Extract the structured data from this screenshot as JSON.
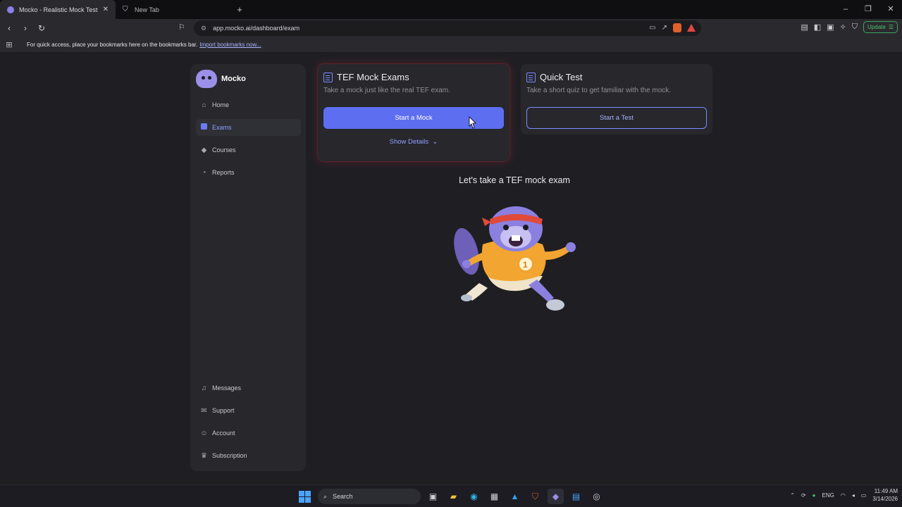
{
  "browser": {
    "tabs": [
      {
        "title": "Mocko - Realistic Mock Tests wi",
        "active": true
      },
      {
        "title": "New Tab",
        "active": false
      }
    ],
    "url": "app.mocko.ai/dashboard/exam",
    "update_label": "Update",
    "bookmarks_message": "For quick access, place your bookmarks here on the bookmarks bar.",
    "bookmarks_link": "Import bookmarks now..."
  },
  "sidebar": {
    "brand": "Mocko",
    "top_items": [
      {
        "label": "Home",
        "icon": "home-icon"
      },
      {
        "label": "Exams",
        "icon": "exams-icon",
        "active": true
      },
      {
        "label": "Courses",
        "icon": "graduation-cap-icon"
      },
      {
        "label": "Reports",
        "icon": "chart-pie-icon"
      }
    ],
    "bottom_items": [
      {
        "label": "Messages",
        "icon": "bell-icon"
      },
      {
        "label": "Support",
        "icon": "mail-icon"
      },
      {
        "label": "Account",
        "icon": "user-icon"
      },
      {
        "label": "Subscription",
        "icon": "crown-icon"
      }
    ]
  },
  "cards": {
    "mock": {
      "title": "TEF Mock Exams",
      "subtitle": "Take a mock just like the real TEF exam.",
      "button": "Start a Mock",
      "details": "Show Details"
    },
    "quick": {
      "title": "Quick Test",
      "subtitle": "Take a short quiz to get familiar with the mock.",
      "button": "Start a Test"
    }
  },
  "main": {
    "prompt": "Let's take a TEF mock exam"
  },
  "taskbar": {
    "search_label": "Search",
    "language": "ENG",
    "time": "11:49 AM",
    "date": "3/14/2026"
  },
  "colors": {
    "accent": "#5d6ef0",
    "accent_light": "#8fa0ff",
    "background": "#1f1f23",
    "panel": "#27272c"
  }
}
